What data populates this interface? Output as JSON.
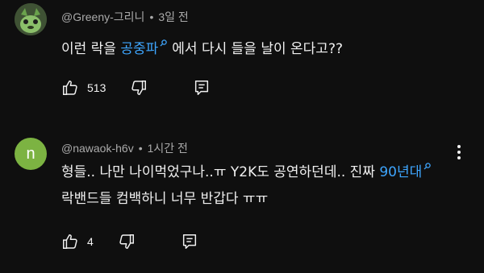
{
  "comments": [
    {
      "author": "@Greeny-그리니",
      "time": "3일 전",
      "text_before": "이런 락을 ",
      "link_text": "공중파",
      "text_after": "에서 다시 들을 날이 온다고??",
      "likes": "513",
      "icons": [
        "thumb-up-icon",
        "thumb-down-icon",
        "reply-icon"
      ]
    },
    {
      "author": "@nawaok-h6v",
      "time": "1시간 전",
      "avatar_letter": "n",
      "avatar_color": "#7cb342",
      "text_before": "형들.. 나만 나이먹었구나..ㅠ Y2K도 공연하던데.. 진짜 ",
      "link_text": "90년대",
      "text_after": " 락밴드들 컴백하니 너무 반갑다 ㅠㅠ",
      "likes": "4",
      "icons": [
        "thumb-up-icon",
        "thumb-down-icon",
        "reply-icon",
        "more-vert-icon"
      ]
    }
  ],
  "separator": "•",
  "colors": {
    "background": "#0f0f0f",
    "text": "#f1f1f1",
    "meta": "#aaaaaa",
    "link": "#3ea6ff"
  }
}
